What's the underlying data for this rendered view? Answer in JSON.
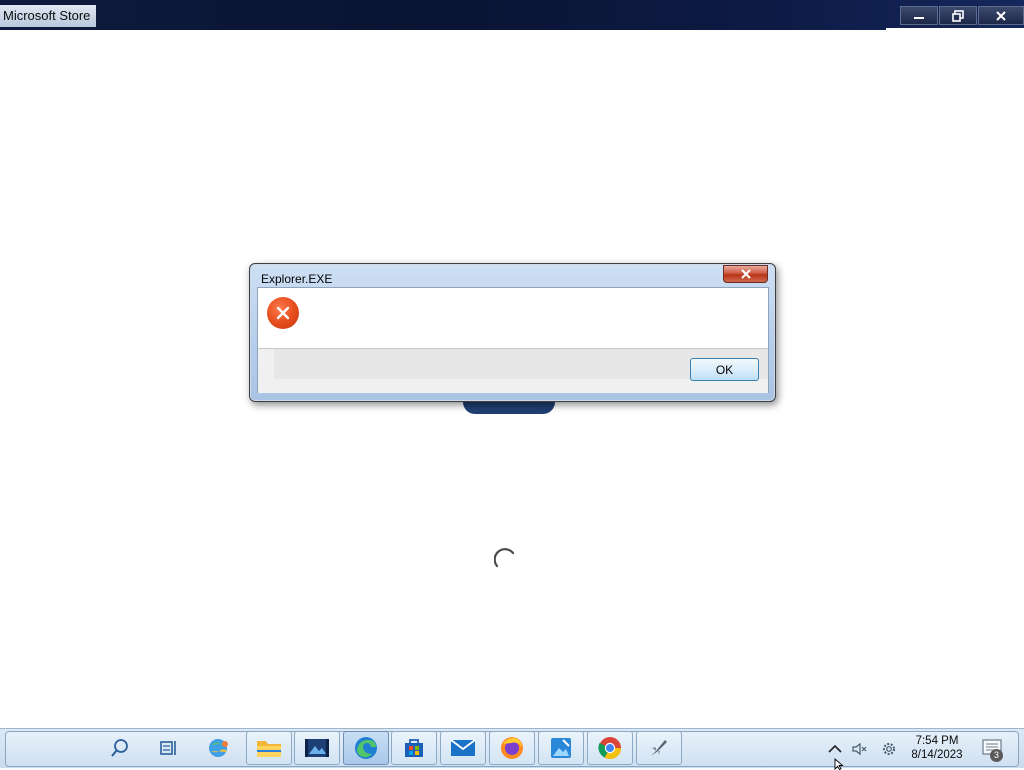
{
  "window": {
    "title": "Microsoft Store",
    "buttons": [
      "minimize",
      "restore",
      "close"
    ]
  },
  "dialog": {
    "title": "Explorer.EXE",
    "icon": "error-icon",
    "ok_label": "OK"
  },
  "taskbar": {
    "items": [
      "search-icon",
      "task-view-icon",
      "widgets-icon",
      "file-explorer-icon",
      "photos-icon",
      "edge-icon",
      "store-icon",
      "mail-icon",
      "firefox-icon",
      "paint-icon",
      "chrome-icon",
      "app-icon"
    ],
    "clock_time": "7:54 PM",
    "clock_date": "8/14/2023",
    "notification_count": "3"
  },
  "colors": {
    "accent": "#0d1a44",
    "error": "#e44a1c",
    "taskbar": "#cfe0f1"
  }
}
